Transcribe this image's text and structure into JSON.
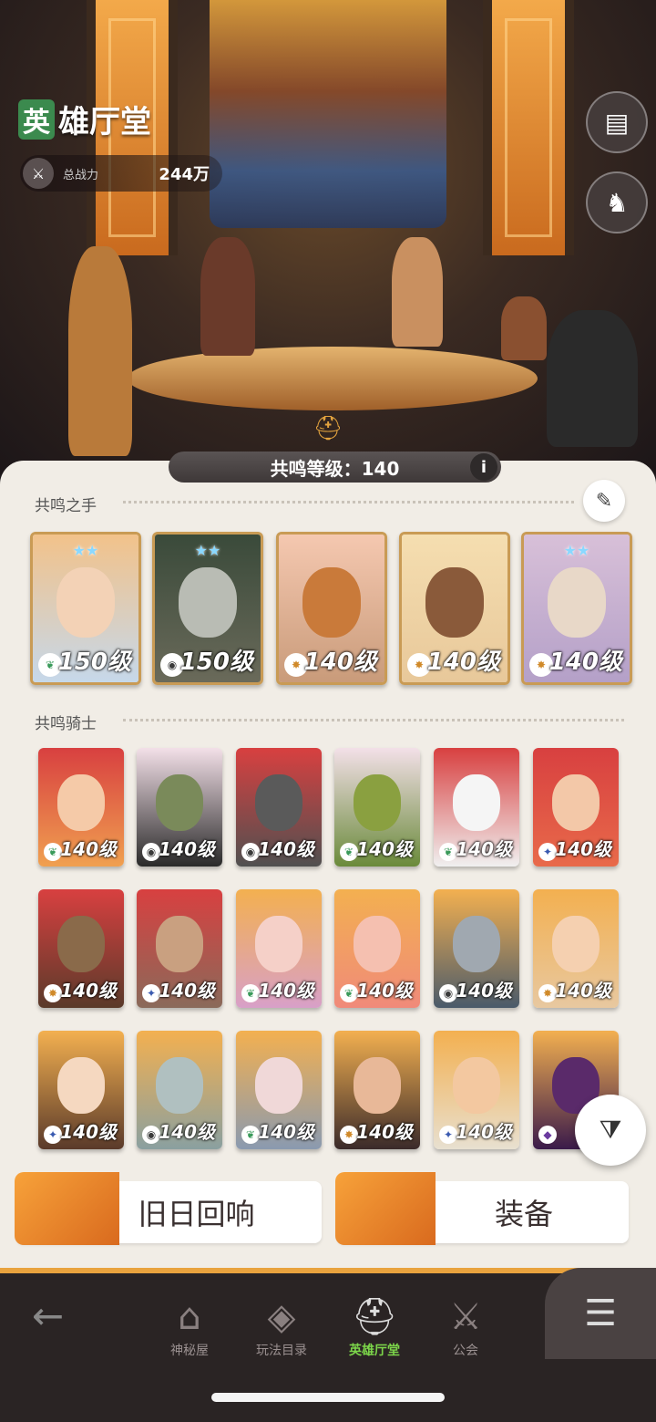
{
  "header": {
    "title_first_char": "英",
    "title_rest": "雄厅堂",
    "power_label": "总战力",
    "power_value": "244万"
  },
  "side_buttons": [
    {
      "icon": "book-icon"
    },
    {
      "icon": "heroes-icon"
    }
  ],
  "resonance": {
    "level_text": "共鸣等级：140",
    "info_label": "i"
  },
  "hands_section": {
    "title": "共鸣之手",
    "cards": [
      {
        "level": "150级",
        "stars": "★★",
        "faction": "forest",
        "colors": [
          "#f2c28a",
          "#c6d8ea"
        ],
        "face": "#f3d2b6"
      },
      {
        "level": "150级",
        "stars": "★★",
        "faction": "undead",
        "colors": [
          "#3a4a3a",
          "#6a6a5a"
        ],
        "face": "#b9bcb4"
      },
      {
        "level": "140级",
        "stars": "",
        "faction": "lightbearer",
        "colors": [
          "#f5c8b0",
          "#c99b7a"
        ],
        "face": "#c97a3a"
      },
      {
        "level": "140级",
        "stars": "",
        "faction": "lightbearer",
        "colors": [
          "#f5deb0",
          "#e8c89a"
        ],
        "face": "#8a5a3a"
      },
      {
        "level": "140级",
        "stars": "★★",
        "faction": "lightbearer",
        "colors": [
          "#d8c0d8",
          "#b4a0c8"
        ],
        "face": "#e8d8c8"
      }
    ]
  },
  "knights_section": {
    "title": "共鸣骑士",
    "rows": [
      [
        {
          "level": "140级",
          "faction": "wilder",
          "colors": [
            "#d84040",
            "#f0a050"
          ],
          "face": "#f5caa8"
        },
        {
          "level": "140级",
          "faction": "graveborn",
          "colors": [
            "#f3e0e8",
            "#2a2a2a"
          ],
          "face": "#7a8a5a"
        },
        {
          "level": "140级",
          "faction": "graveborn",
          "colors": [
            "#d84040",
            "#505050"
          ],
          "face": "#5a5a5a"
        },
        {
          "level": "140级",
          "faction": "wilder",
          "colors": [
            "#f3e0e8",
            "#6a8a3a"
          ],
          "face": "#8aa040"
        },
        {
          "level": "140级",
          "faction": "wilder",
          "colors": [
            "#d84040",
            "#f0f0f0"
          ],
          "face": "#f5f5f5"
        },
        {
          "level": "140级",
          "faction": "mauler",
          "colors": [
            "#d84040",
            "#e86a4a"
          ],
          "face": "#f3c8a8"
        }
      ],
      [
        {
          "level": "140级",
          "faction": "lightbearer",
          "colors": [
            "#d84040",
            "#5a3a2a"
          ],
          "face": "#8a6a4a"
        },
        {
          "level": "140级",
          "faction": "mauler",
          "colors": [
            "#d84040",
            "#8a6a5a"
          ],
          "face": "#c9a080"
        },
        {
          "level": "140级",
          "faction": "wilder",
          "colors": [
            "#f3b050",
            "#d8a0c8"
          ],
          "face": "#f5d0c8"
        },
        {
          "level": "140级",
          "faction": "wilder",
          "colors": [
            "#f3b050",
            "#f08a7a"
          ],
          "face": "#f5c0b0"
        },
        {
          "level": "140级",
          "faction": "graveborn",
          "colors": [
            "#f3b050",
            "#4a5a6a"
          ],
          "face": "#a0a8b0"
        },
        {
          "level": "140级",
          "faction": "lightbearer",
          "colors": [
            "#f3b050",
            "#e8c8a0"
          ],
          "face": "#f5d0b0"
        }
      ],
      [
        {
          "level": "140级",
          "faction": "mauler",
          "colors": [
            "#f3b050",
            "#5a3a2a"
          ],
          "face": "#f5d8c0"
        },
        {
          "level": "140级",
          "faction": "graveborn",
          "colors": [
            "#f3b050",
            "#8aa0a0"
          ],
          "face": "#b0c0c0"
        },
        {
          "level": "140级",
          "faction": "wilder",
          "colors": [
            "#f3b050",
            "#8a9ab0"
          ],
          "face": "#f0d8d8"
        },
        {
          "level": "140级",
          "faction": "lightbearer",
          "colors": [
            "#f3b050",
            "#3a2a2a"
          ],
          "face": "#e8b898"
        },
        {
          "level": "140级",
          "faction": "mauler",
          "colors": [
            "#f3b050",
            "#e8e0d0"
          ],
          "face": "#f3c8a0"
        },
        {
          "level": "14",
          "faction": "hypogean",
          "colors": [
            "#f3b050",
            "#3a1a4a"
          ],
          "face": "#5a2a6a"
        }
      ]
    ]
  },
  "actions": {
    "echoes_label": "旧日回响",
    "equipment_label": "装备"
  },
  "nav": {
    "back_label": "←",
    "items": [
      {
        "label": "神秘屋",
        "icon": "mystic-house-icon"
      },
      {
        "label": "玩法目录",
        "icon": "game-modes-icon"
      },
      {
        "label": "英雄厅堂",
        "icon": "hero-hall-icon",
        "active": true
      },
      {
        "label": "公会",
        "icon": "guild-icon"
      }
    ],
    "menu_icon": "menu-icon"
  }
}
